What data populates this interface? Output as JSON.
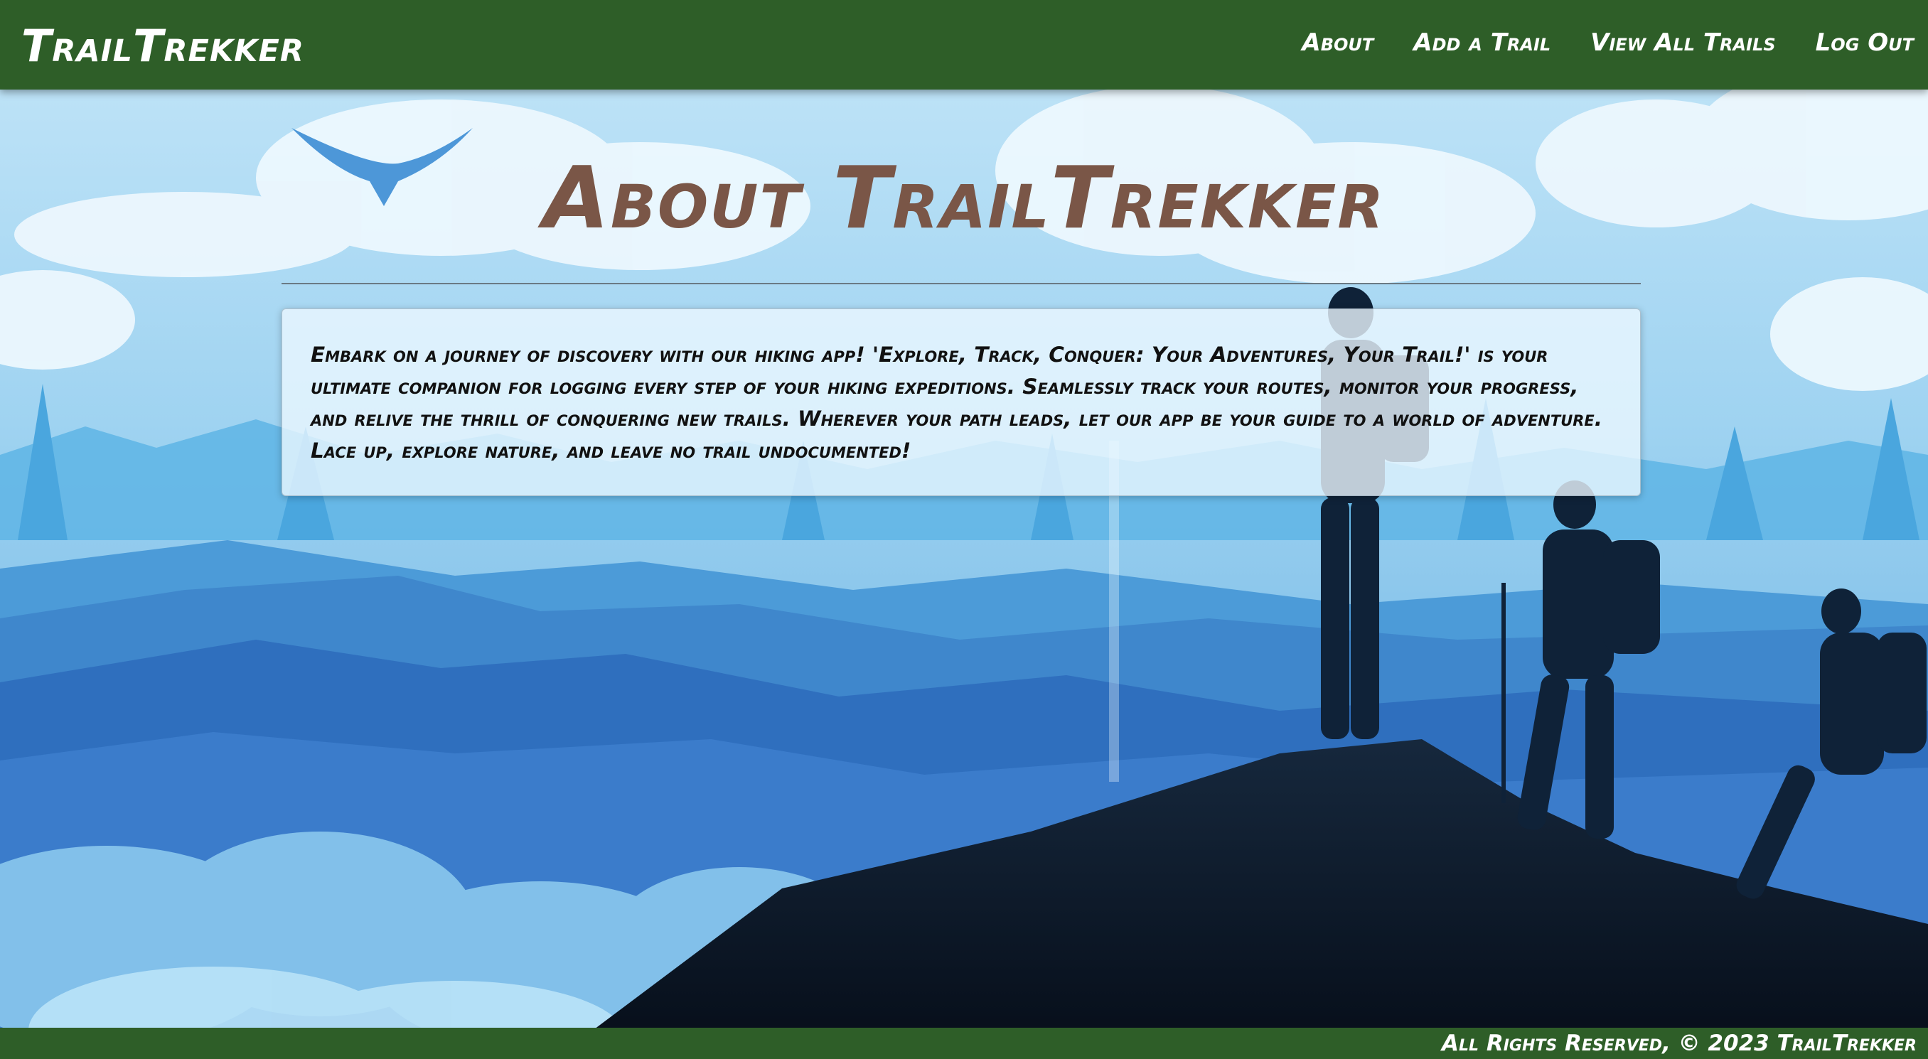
{
  "navbar": {
    "brand": "TrailTrekker",
    "links": [
      {
        "label": "About"
      },
      {
        "label": "Add a Trail"
      },
      {
        "label": "View All Trails"
      },
      {
        "label": "Log Out"
      }
    ],
    "color": "#2e5e28"
  },
  "main": {
    "title": "About TrailTrekker",
    "description": "Embark on a journey of discovery with our hiking app! 'Explore, Track, Conquer: Your Adventures, Your Trail!' is your ultimate companion for logging every step of your hiking expeditions. Seamlessly track your routes, monitor your progress, and relive the thrill of conquering new trails. Wherever your path leads, let our app be your guide to a world of adventure. Lace up, explore nature, and leave no trail undocumented!",
    "title_color": "#7a5647"
  },
  "footer": {
    "text": "All Rights Reserved, © 2023 TrailTrekker"
  },
  "background": {
    "icon": "mountain-hikers-illustration"
  }
}
